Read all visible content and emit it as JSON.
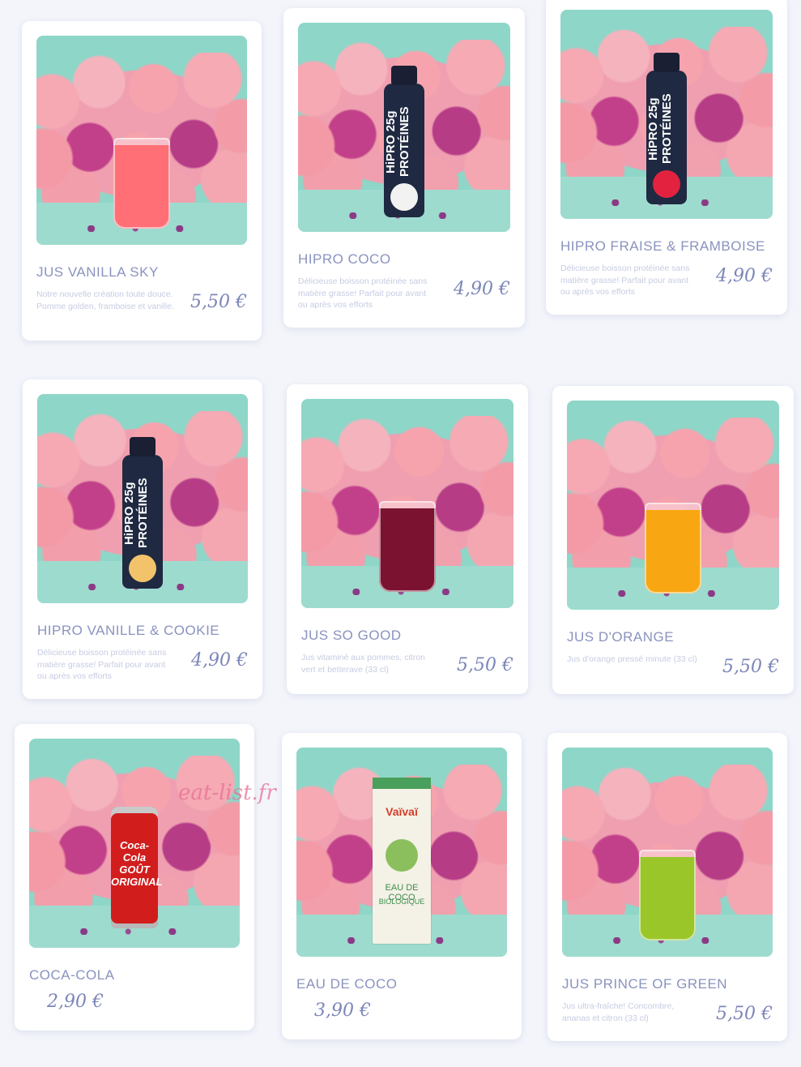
{
  "colors": {
    "background": "#f3f5fb",
    "card": "#ffffff",
    "title": "#8a93bf",
    "description": "#c7cce2",
    "price": "#7c86b8",
    "photo_backdrop": "#8ed6c8"
  },
  "watermark": "eat-list.fr",
  "products": [
    {
      "name": "JUS VANILLA SKY",
      "description": "Notre nouvelle création toute douce. Pomme golden, framboise et vanille.",
      "price": "5,50 €",
      "visual": "glass",
      "liquid_color": "#ff6f75"
    },
    {
      "name": "HIPRO COCO",
      "description": "Délicieuse boisson protéinée sans matière grasse! Parfait pour avant ou après vos efforts",
      "price": "4,90 €",
      "visual": "bottle",
      "bottle_text": "HiPRO 25g PROTÉINES",
      "fruit_color": "#f2f2f2"
    },
    {
      "name": "HIPRO FRAISE & FRAMBOISE",
      "description": "Délicieuse boisson protéinée sans matière grasse! Parfait pour avant ou après vos efforts",
      "price": "4,90 €",
      "visual": "bottle",
      "bottle_text": "HiPRO 25g PROTÉINES",
      "fruit_color": "#e3223f"
    },
    {
      "name": "HIPRO VANILLE & COOKIE",
      "description": "Délicieuse boisson protéinée sans matière grasse! Parfait pour avant ou après vos efforts",
      "price": "4,90 €",
      "visual": "bottle",
      "bottle_text": "HiPRO 25g PROTÉINES",
      "fruit_color": "#f2c36a"
    },
    {
      "name": "JUS SO GOOD",
      "description": "Jus vitaminé aux pommes, citron vert et betterave (33 cl)",
      "price": "5,50 €",
      "visual": "glass",
      "liquid_color": "#7a1230"
    },
    {
      "name": "JUS D'ORANGE",
      "description": "Jus d'orange pressé minute (33 cl)",
      "price": "5,50 €",
      "visual": "glass",
      "liquid_color": "#f8a612"
    },
    {
      "name": "COCA-COLA",
      "description": "",
      "price": "2,90 €",
      "visual": "can",
      "can_text": "Coca-Cola GOÛT ORIGINAL"
    },
    {
      "name": "EAU DE COCO",
      "description": "",
      "price": "3,90 €",
      "visual": "carton",
      "carton_brand": "Vaïvaï",
      "carton_text": "EAU DE COCO",
      "carton_sub": "BIOLOGIQUE"
    },
    {
      "name": "JUS PRINCE OF GREEN",
      "description": "Jus ultra-fraîche! Concombre, ananas et citron (33 cl)",
      "price": "5,50 €",
      "visual": "glass",
      "liquid_color": "#9bc62a"
    }
  ]
}
